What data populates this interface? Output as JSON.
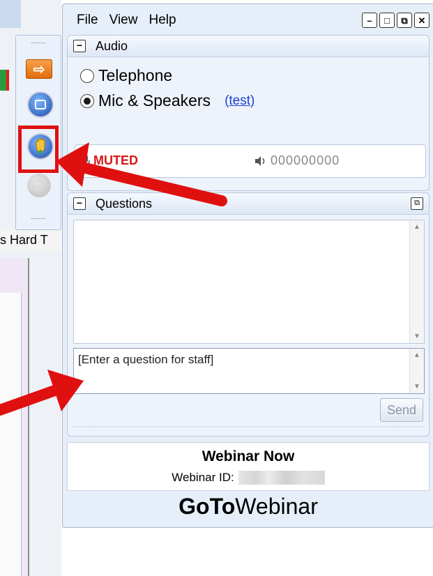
{
  "background": {
    "tab_text": "s Hard T"
  },
  "toolbar": {
    "icons": [
      "show-panel-arrow-icon",
      "screen-share-icon",
      "raise-hand-icon",
      "disabled-icon"
    ]
  },
  "menu": {
    "file": "File",
    "view": "View",
    "help": "Help"
  },
  "window_buttons": {
    "minimize": "–",
    "restore": "□",
    "popout": "⧉",
    "close": "✕"
  },
  "audio": {
    "title": "Audio",
    "option_telephone": "Telephone",
    "option_mic": "Mic & Speakers",
    "test_link": "(test)",
    "selected": "Mic & Speakers",
    "status": "MUTED",
    "level_meter": "000000000"
  },
  "questions": {
    "title": "Questions",
    "input_placeholder": "[Enter a question for staff]",
    "send_label": "Send"
  },
  "info": {
    "webinar_name": "Webinar Now",
    "webinar_id_label": "Webinar ID:"
  },
  "branding": {
    "logo_bold": "GoTo",
    "logo_regular": "Webinar"
  },
  "colors": {
    "annotation_red": "#e01010",
    "muted_red": "#d81818",
    "link_blue": "#1a3fd0",
    "window_bg": "#e6eef9"
  }
}
